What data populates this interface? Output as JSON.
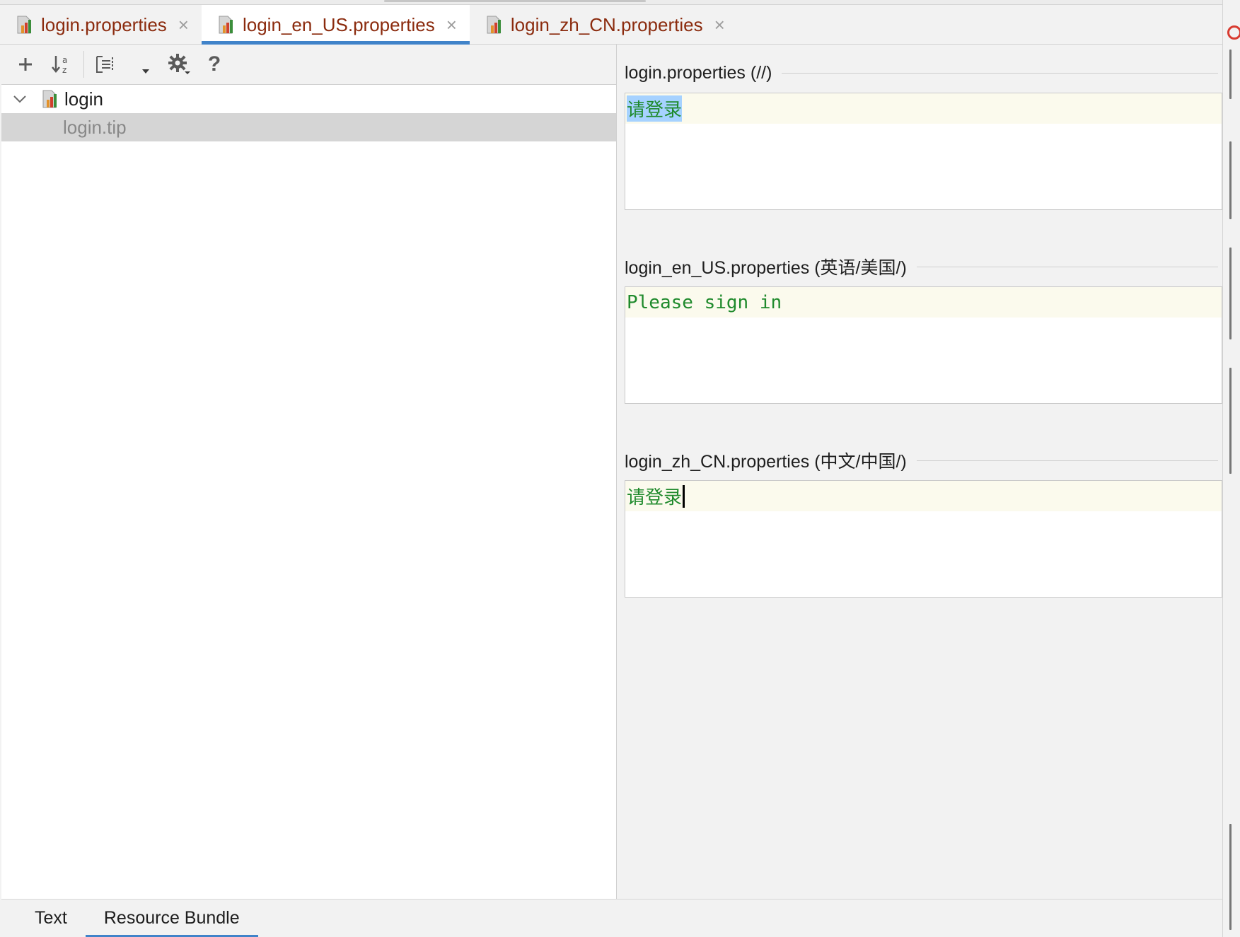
{
  "editor_tabs": [
    {
      "label": "login.properties",
      "active": false
    },
    {
      "label": "login_en_US.properties",
      "active": true
    },
    {
      "label": "login_zh_CN.properties",
      "active": false
    }
  ],
  "toolbar": {
    "add_icon": "plus-icon",
    "sort_icon": "sort-alphabetically-icon",
    "group_icon": "group-by-prefix-icon",
    "settings_icon": "gear-icon",
    "help_label": "?"
  },
  "tree": {
    "root_label": "login",
    "child_label": "login.tip"
  },
  "sections": [
    {
      "title": "login.properties (//)",
      "value": "请登录"
    },
    {
      "title": "login_en_US.properties (英语/美国/)",
      "value": "Please sign in"
    },
    {
      "title": "login_zh_CN.properties (中文/中国/)",
      "value": "请登录"
    }
  ],
  "bottom_tabs": [
    {
      "label": "Text",
      "active": false
    },
    {
      "label": "Resource Bundle",
      "active": true
    }
  ],
  "colors": {
    "tab_text": "#8b2b0e",
    "accent": "#4083c9",
    "value_text": "#1f8a2c",
    "selection": "#a6d2ff",
    "line_highlight": "#fbfaed"
  }
}
